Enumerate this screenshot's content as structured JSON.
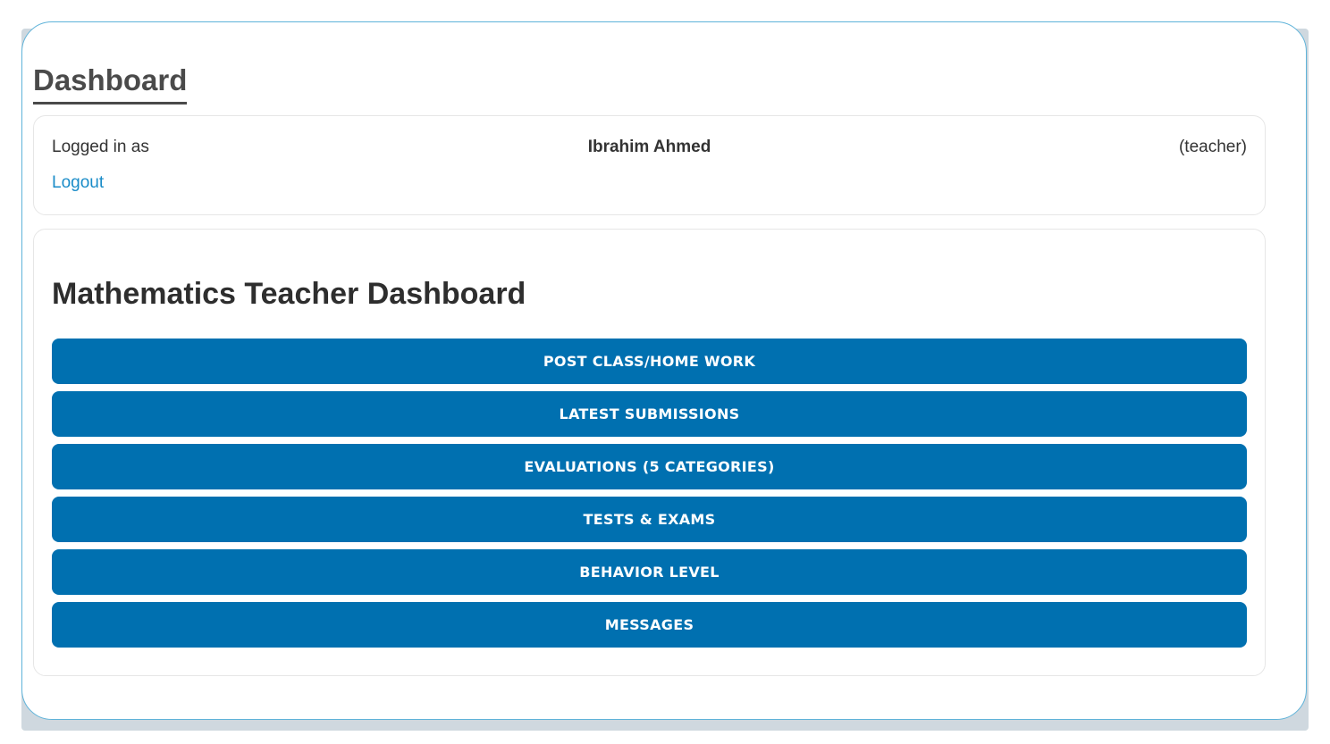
{
  "header": {
    "title": "Dashboard"
  },
  "user": {
    "logged_in_label": "Logged in as",
    "name": "Ibrahim Ahmed",
    "role": "(teacher)",
    "logout_label": "Logout"
  },
  "main": {
    "section_title": "Mathematics Teacher Dashboard",
    "menu": [
      {
        "label": "Post Class/Home Work"
      },
      {
        "label": "Latest Submissions"
      },
      {
        "label": "Evaluations (5 categories)"
      },
      {
        "label": "Tests & Exams"
      },
      {
        "label": "Behavior Level"
      },
      {
        "label": "Messages"
      }
    ]
  },
  "colors": {
    "accent": "#0070b0",
    "link": "#1a8cc8",
    "frame_border": "#5fb3d9"
  }
}
